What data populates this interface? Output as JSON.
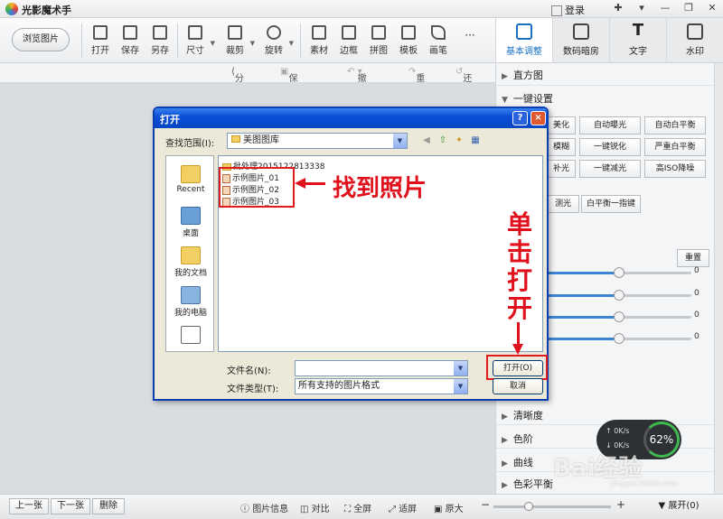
{
  "app": {
    "title": "光影魔术手",
    "login": "登录"
  },
  "toolbar": {
    "browse": "浏览图片",
    "tools": [
      "打开",
      "保存",
      "另存",
      "尺寸",
      "裁剪",
      "旋转",
      "素材",
      "边框",
      "拼图",
      "模板",
      "画笔"
    ],
    "more": "···"
  },
  "right_tabs": [
    "基本调整",
    "数码暗房",
    "文字",
    "水印"
  ],
  "subbar": {
    "share": "分享",
    "save_action": "保存动作",
    "undo": "撤销",
    "redo": "重做",
    "restore": "还原"
  },
  "panel": {
    "histogram": "直方图",
    "one_click": "一键设置",
    "buttons": [
      "美化",
      "自动曝光",
      "自动白平衡",
      "模糊",
      "一键锐化",
      "严重白平衡",
      "补光",
      "一键减光",
      "高ISO降噪",
      "测光",
      "白平衡一指键"
    ],
    "reset": "重置",
    "slider_values": [
      "0",
      "0",
      "0",
      "0"
    ],
    "slider_levels": [
      0.5,
      0.5,
      0.5,
      0.5
    ],
    "sections": [
      "清晰度",
      "色阶",
      "曲线",
      "色彩平衡"
    ]
  },
  "dialog": {
    "title": "打开",
    "help": "?",
    "close": "×",
    "look_in_label": "查找范围(I):",
    "look_in_value": "美图图库",
    "places": [
      "Recent",
      "桌面",
      "我的文档",
      "我的电脑"
    ],
    "folder": "批处理2015122813338",
    "files": [
      "示例图片_01",
      "示例图片_02",
      "示例图片_03"
    ],
    "filename_label": "文件名(N):",
    "filename_value": "",
    "filetype_label": "文件类型(T):",
    "filetype_value": "所有支持的图片格式",
    "open_button": "打开(O)",
    "cancel_button": "取消"
  },
  "annotations": {
    "find_photo": "找到照片",
    "click_open": [
      "单",
      "击",
      "打",
      "开"
    ]
  },
  "status": {
    "prev": "上一张",
    "next": "下一张",
    "delete": "删除",
    "info": "图片信息",
    "compare": "对比",
    "fullscreen": "全屏",
    "fit": "适屏",
    "original": "原大",
    "expand": "展开(0)"
  },
  "network": {
    "up": "0K/s",
    "down": "0K/s",
    "percent": "62%"
  },
  "watermark": {
    "brand": "Bai经验",
    "url": "jingyan.baidu.com"
  },
  "colors": {
    "accent": "#1a6fc0",
    "annotation": "#e0111d",
    "dialog_title": "#0a4fd6"
  }
}
